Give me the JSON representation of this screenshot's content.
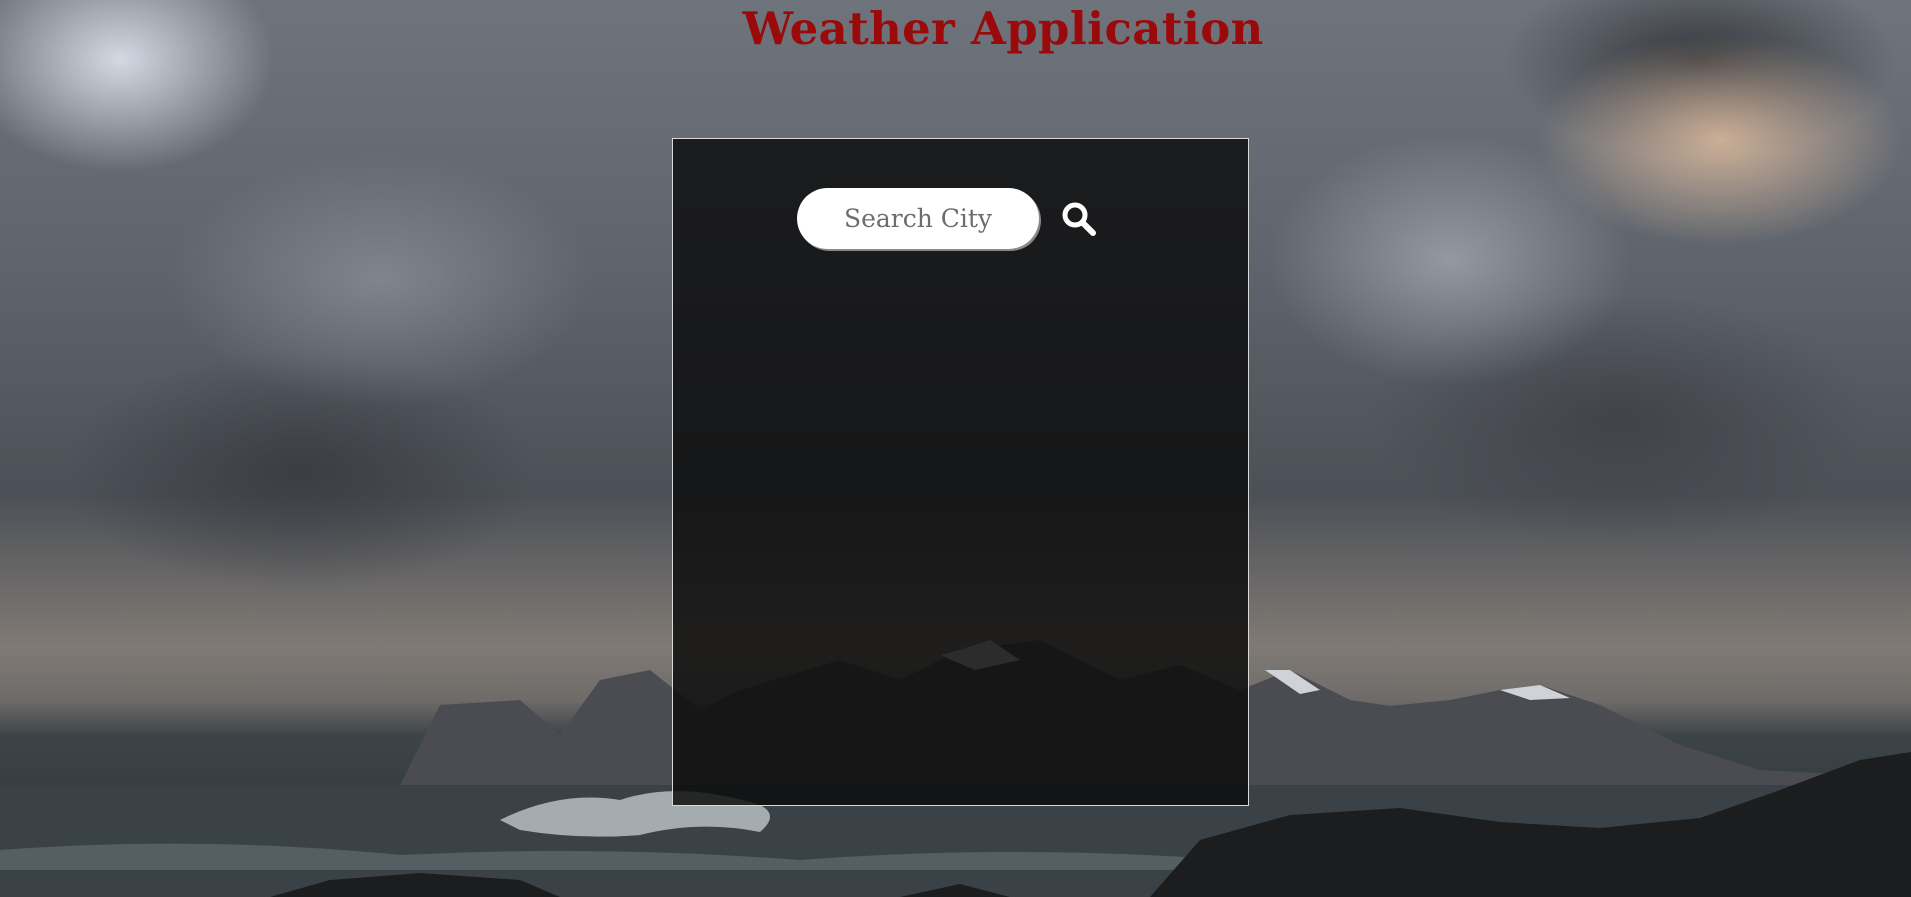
{
  "header": {
    "title": "Weather Application"
  },
  "search": {
    "placeholder": "Search City",
    "value": "",
    "button_icon": "search-icon"
  },
  "colors": {
    "title": "#9b0a0a",
    "card_border": "#d9d9d9",
    "card_background": "#0c0c0c"
  }
}
